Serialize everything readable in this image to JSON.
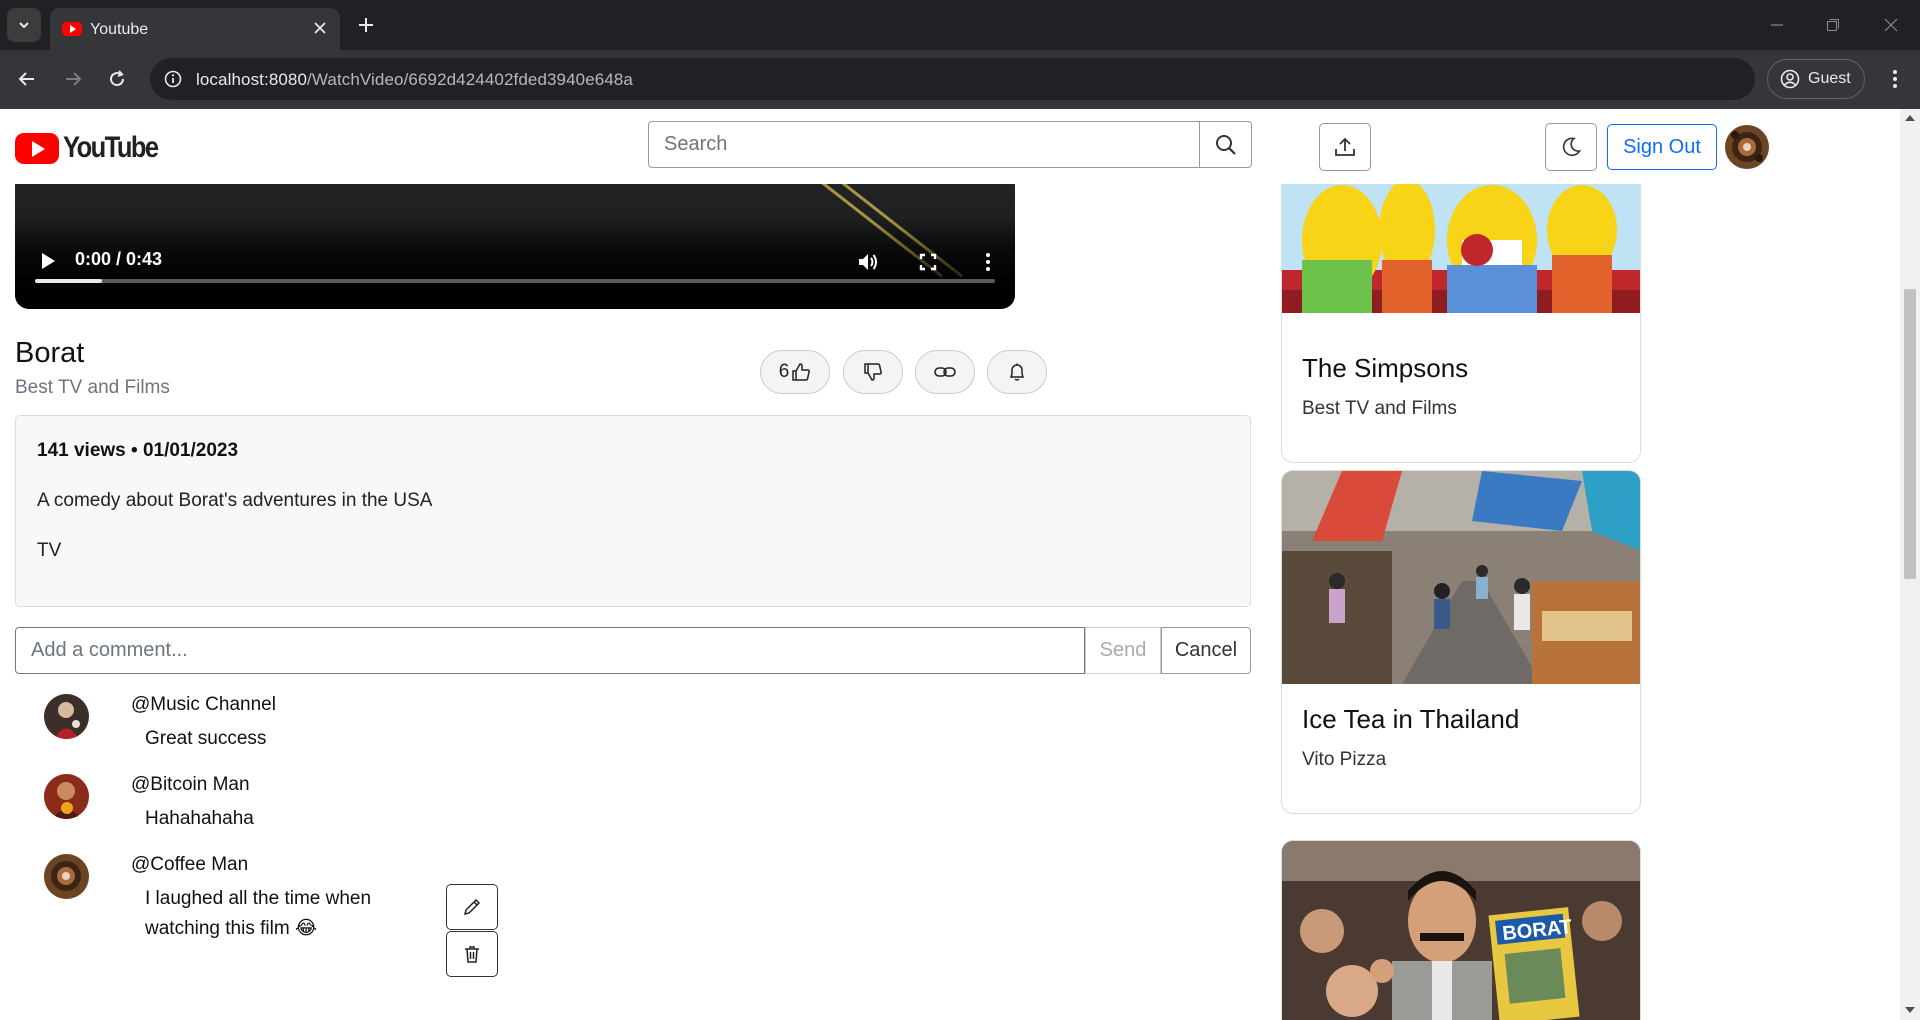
{
  "browser": {
    "tab_title": "Youtube",
    "url_host": "localhost:8080",
    "url_path": "/WatchVideo/6692d424402fded3940e648a",
    "guest_label": "Guest"
  },
  "header": {
    "logo_text": "YouTube",
    "search_placeholder": "Search",
    "sign_out_label": "Sign Out"
  },
  "player": {
    "time": "0:00 / 0:43",
    "progress_fraction": 0.07
  },
  "video": {
    "title": "Borat",
    "channel": "Best TV and Films",
    "likes": "6",
    "views_date": "141 views • 01/01/2023",
    "description": "A comedy about Borat's adventures in the USA",
    "category": "TV"
  },
  "comment_form": {
    "placeholder": "Add a comment...",
    "send_label": "Send",
    "cancel_label": "Cancel"
  },
  "comments": [
    {
      "user": "@Music Channel",
      "text": "Great success"
    },
    {
      "user": "@Bitcoin Man",
      "text": "Hahahahaha"
    },
    {
      "user": "@Coffee Man",
      "text": "I laughed all the time when watching this film 😂"
    }
  ],
  "sidebar": {
    "cards": [
      {
        "title": "The Simpsons",
        "channel": "Best TV and Films"
      },
      {
        "title": "Ice Tea in Thailand",
        "channel": "Vito Pizza"
      },
      {
        "title": "",
        "channel": ""
      }
    ]
  },
  "colors": {
    "brand_red": "#ff0000",
    "primary_blue": "#0d6efd"
  }
}
